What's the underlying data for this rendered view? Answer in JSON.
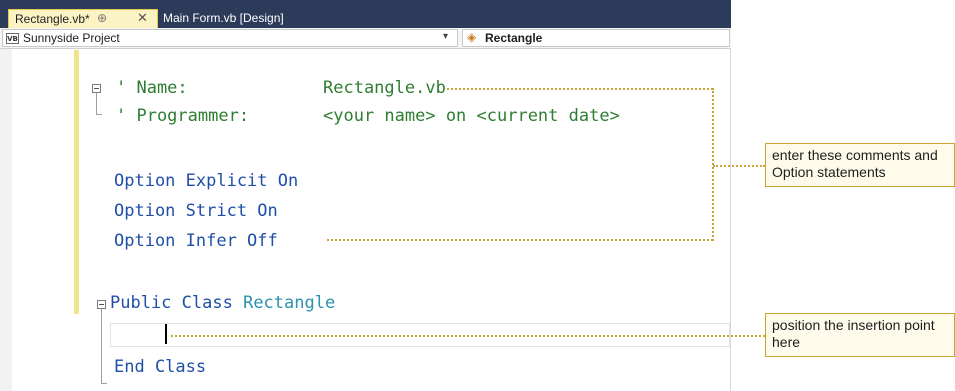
{
  "tabs": {
    "active": {
      "label": "Rectangle.vb*",
      "pin": "⊕",
      "close": "✕"
    },
    "inactive": {
      "label": "Main Form.vb [Design]"
    }
  },
  "navbar": {
    "project_icon": "VB",
    "project_combo": "Sunnyside Project",
    "member_combo": "Rectangle"
  },
  "code": {
    "line1_prefix": "' Name:",
    "line1_value": "Rectangle.vb",
    "line2_prefix": "' Programmer:",
    "line2_value": "<your name> on <current date>",
    "opt1": "Option Explicit On",
    "opt2": "Option Strict On",
    "opt3": "Option Infer Off",
    "class_kw": "Public Class",
    "class_name": "Rectangle",
    "end_class": "End Class"
  },
  "callouts": {
    "comments": "enter these comments and Option statements",
    "insertion": "position the insertion point here"
  },
  "colors": {
    "comment": "#2e7d32",
    "keyword": "#1f4fa8",
    "type": "#2b91af",
    "callout_border": "#c8a530",
    "tab_active_bg": "#fcf3c4"
  }
}
